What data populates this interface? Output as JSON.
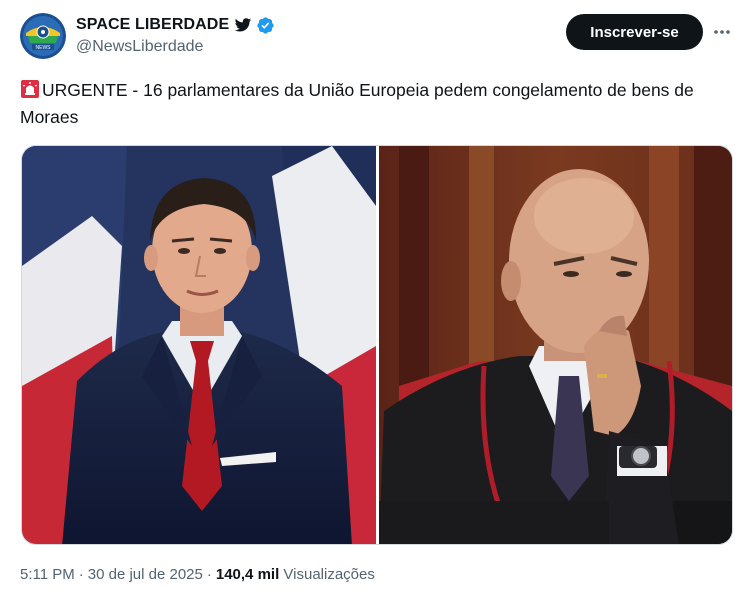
{
  "author": {
    "display_name": "SPACE LIBERDADE",
    "handle": "@NewsLiberdade",
    "avatar_icon": "space-liberdade-logo",
    "verified": true,
    "badge_color": "#1d9bf0"
  },
  "actions": {
    "subscribe_label": "Inscrever-se",
    "more_icon": "more-horizontal-icon"
  },
  "tweet": {
    "text": "URGENTE - 16 parlamentares da União Europeia pedem congelamento de bens de Moraes",
    "leading_emoji": "siren-icon"
  },
  "media": {
    "count": 2
  },
  "meta": {
    "time": "5:11 PM",
    "date": "30 de jul de 2025",
    "views_count": "140,4 mil",
    "views_label": "Visualizações",
    "separator": "·"
  },
  "colors": {
    "text_primary": "#0f1419",
    "text_secondary": "#536471",
    "button_bg": "#0f1419",
    "verified": "#1d9bf0"
  }
}
